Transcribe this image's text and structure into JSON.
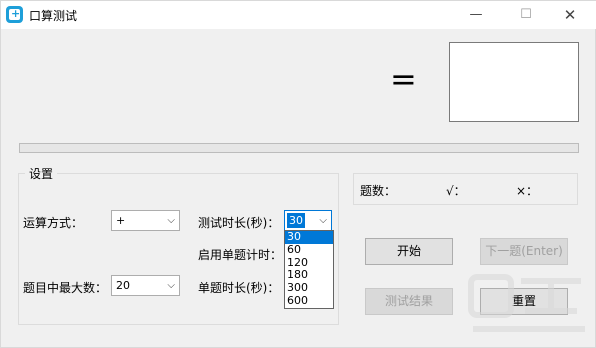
{
  "window": {
    "title": "口算测试",
    "controls": {
      "minimize": "—",
      "maximize": "☐",
      "close": "✕"
    }
  },
  "equation": {
    "equals_sign": "=",
    "answer": ""
  },
  "progress": {
    "value": 0
  },
  "settings": {
    "legend": "设置",
    "operation_label": "运算方式：",
    "operation_value": "+",
    "max_number_label": "题目中最大数：",
    "max_number_value": "20",
    "test_duration_label": "测试时长(秒)：",
    "test_duration_value": "30",
    "test_duration_options": [
      "30",
      "60",
      "120",
      "180",
      "300",
      "600"
    ],
    "single_timer_label": "启用单题计时：",
    "single_duration_label": "单题时长(秒)："
  },
  "counts": {
    "question_count_label": "题数：",
    "correct_label": "√：",
    "wrong_label": "×："
  },
  "buttons": {
    "start": "开始",
    "next": "下一题(Enter)",
    "results": "测试结果",
    "reset": "重置"
  },
  "colors": {
    "accent": "#0078d7",
    "background": "#f0f0f0",
    "icon": "#1e9fd9"
  }
}
